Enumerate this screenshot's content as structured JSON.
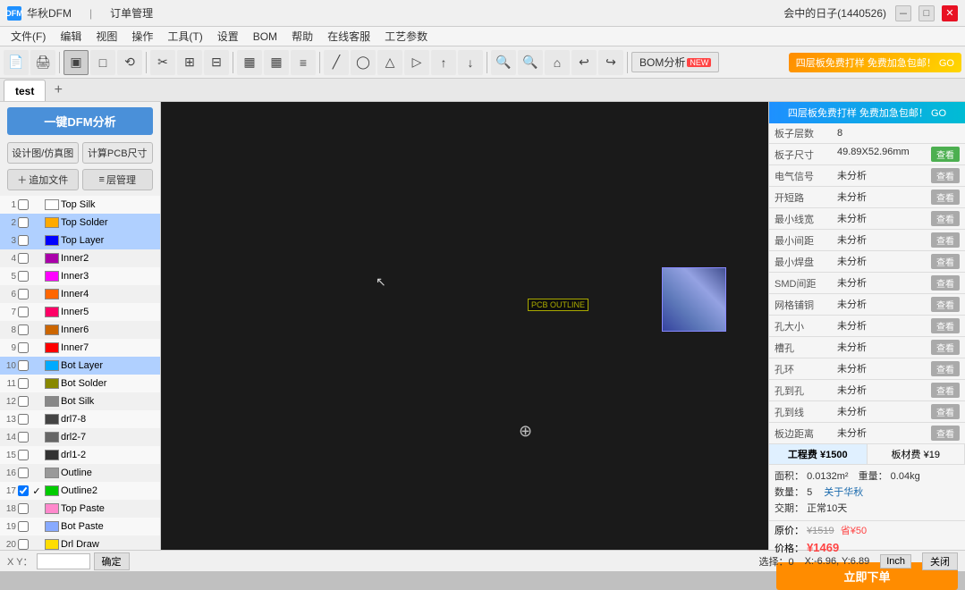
{
  "titleBar": {
    "logo": "DFM",
    "appName": "华秋DFM",
    "moduleName": "订单管理",
    "user": "会中的日子(1440526)",
    "minBtn": "－",
    "maxBtn": "□",
    "closeBtn": "✕"
  },
  "menuBar": {
    "items": [
      "文件(F)",
      "编辑",
      "视图",
      "操作",
      "工具(T)",
      "设置",
      "BOM",
      "帮助",
      "在线客服",
      "工艺参数"
    ]
  },
  "toolbar": {
    "buttons": [
      "□",
      "□",
      "□",
      "▣",
      "□",
      "⟲",
      "✂",
      "⊟",
      "⊞",
      "⊟",
      "▦",
      "▦",
      "≡",
      "╱",
      "◯",
      "△",
      "▷",
      "➚",
      "↓",
      "⊕",
      "⊖",
      "⌂",
      "↩",
      "↪"
    ],
    "bomLabel": "BOM分析",
    "bomNew": "NEW",
    "adBanner": "四层板免费打样 免费加急包邮！ GO"
  },
  "tabs": {
    "items": [
      "test"
    ],
    "addLabel": "+"
  },
  "leftPanel": {
    "dfmBtn": "一键DFM分析",
    "subBtn1": "设计图/仿真图",
    "subBtn2": "计算PCB尺寸",
    "addFileBtn": "追加文件",
    "layerMgrBtn": "层管理",
    "layers": [
      {
        "num": "1",
        "color": "#ffffff",
        "name": "Top Silk",
        "checked": false,
        "visible": false
      },
      {
        "num": "2",
        "color": "#ffaa00",
        "name": "Top Solder",
        "checked": false,
        "visible": false,
        "highlighted": true
      },
      {
        "num": "3",
        "color": "#0000ff",
        "name": "Top Layer",
        "checked": false,
        "visible": false,
        "highlighted": true
      },
      {
        "num": "4",
        "color": "#aa00aa",
        "name": "Inner2",
        "checked": false,
        "visible": false
      },
      {
        "num": "5",
        "color": "#ff00ff",
        "name": "Inner3",
        "checked": false,
        "visible": false
      },
      {
        "num": "6",
        "color": "#ff6600",
        "name": "Inner4",
        "checked": false,
        "visible": false
      },
      {
        "num": "7",
        "color": "#ff0066",
        "name": "Inner5",
        "checked": false,
        "visible": false
      },
      {
        "num": "8",
        "color": "#cc6600",
        "name": "Inner6",
        "checked": false,
        "visible": false
      },
      {
        "num": "9",
        "color": "#ff0000",
        "name": "Inner7",
        "checked": false,
        "visible": false
      },
      {
        "num": "10",
        "color": "#00aaff",
        "name": "Bot Layer",
        "checked": false,
        "visible": false,
        "highlighted": true
      },
      {
        "num": "11",
        "color": "#888800",
        "name": "Bot Solder",
        "checked": false,
        "visible": false
      },
      {
        "num": "12",
        "color": "#888888",
        "name": "Bot Silk",
        "checked": false,
        "visible": false
      },
      {
        "num": "13",
        "color": "#444444",
        "name": "drl7-8",
        "checked": false,
        "visible": false
      },
      {
        "num": "14",
        "color": "#666666",
        "name": "drl2-7",
        "checked": false,
        "visible": false
      },
      {
        "num": "15",
        "color": "#333333",
        "name": "drl1-2",
        "checked": false,
        "visible": false
      },
      {
        "num": "16",
        "color": "#999999",
        "name": "Outline",
        "checked": false,
        "visible": false
      },
      {
        "num": "17",
        "color": "#00cc00",
        "name": "Outline2",
        "checked": true,
        "visible": true
      },
      {
        "num": "18",
        "color": "#ff88cc",
        "name": "Top Paste",
        "checked": false,
        "visible": false
      },
      {
        "num": "19",
        "color": "#88aaff",
        "name": "Bot Paste",
        "checked": false,
        "visible": false
      },
      {
        "num": "20",
        "color": "#ffdd00",
        "name": "Drl Draw",
        "checked": false,
        "visible": false
      }
    ]
  },
  "rightPanel": {
    "topBanner": "四层板免费打样 免费加急包邮！ GO",
    "properties": [
      {
        "label": "板子层数",
        "value": "8",
        "hasBtn": false
      },
      {
        "label": "板子尺寸",
        "value": "49.89X52.96mm",
        "hasBtn": true,
        "btnLabel": "查看",
        "btnColor": "green"
      },
      {
        "label": "电气信号",
        "value": "未分析",
        "hasBtn": true,
        "btnLabel": "查看"
      },
      {
        "label": "开短路",
        "value": "未分析",
        "hasBtn": true,
        "btnLabel": "查看"
      },
      {
        "label": "最小线宽",
        "value": "未分析",
        "hasBtn": true,
        "btnLabel": "查看"
      },
      {
        "label": "最小间距",
        "value": "未分析",
        "hasBtn": true,
        "btnLabel": "查看"
      },
      {
        "label": "最小焊盘",
        "value": "未分析",
        "hasBtn": true,
        "btnLabel": "查看"
      },
      {
        "label": "SMD间距",
        "value": "未分析",
        "hasBtn": true,
        "btnLabel": "查看"
      },
      {
        "label": "网格铺铜",
        "value": "未分析",
        "hasBtn": true,
        "btnLabel": "查看"
      },
      {
        "label": "孔大小",
        "value": "未分析",
        "hasBtn": true,
        "btnLabel": "查看"
      },
      {
        "label": "槽孔",
        "value": "未分析",
        "hasBtn": true,
        "btnLabel": "查看"
      },
      {
        "label": "孔环",
        "value": "未分析",
        "hasBtn": true,
        "btnLabel": "查看"
      },
      {
        "label": "孔到孔",
        "value": "未分析",
        "hasBtn": true,
        "btnLabel": "查看"
      },
      {
        "label": "孔到线",
        "value": "未分析",
        "hasBtn": true,
        "btnLabel": "查看"
      },
      {
        "label": "板边距离",
        "value": "未分析",
        "hasBtn": true,
        "btnLabel": "查看"
      }
    ],
    "costTabs": [
      {
        "label": "工程费",
        "value": "¥1500"
      },
      {
        "label": "板材费",
        "value": "¥19"
      }
    ],
    "area": "0.0132m²",
    "weight": "0.04kg",
    "quantity": "5",
    "huaqiuLink": "关于华秋",
    "delivery": "正常10天",
    "originalPrice": "¥1519",
    "discount": "省¥50",
    "finalPrice": "¥1469",
    "orderBtn": "立即下单"
  },
  "statusBar": {
    "xyLabel": "X Y：",
    "xyPlaceholder": "",
    "confirmBtn": "确定",
    "selectionText": "选择：0",
    "coords": "X:-6.96, Y:6.89",
    "unit": "Inch",
    "closeLabel": "关闭"
  }
}
